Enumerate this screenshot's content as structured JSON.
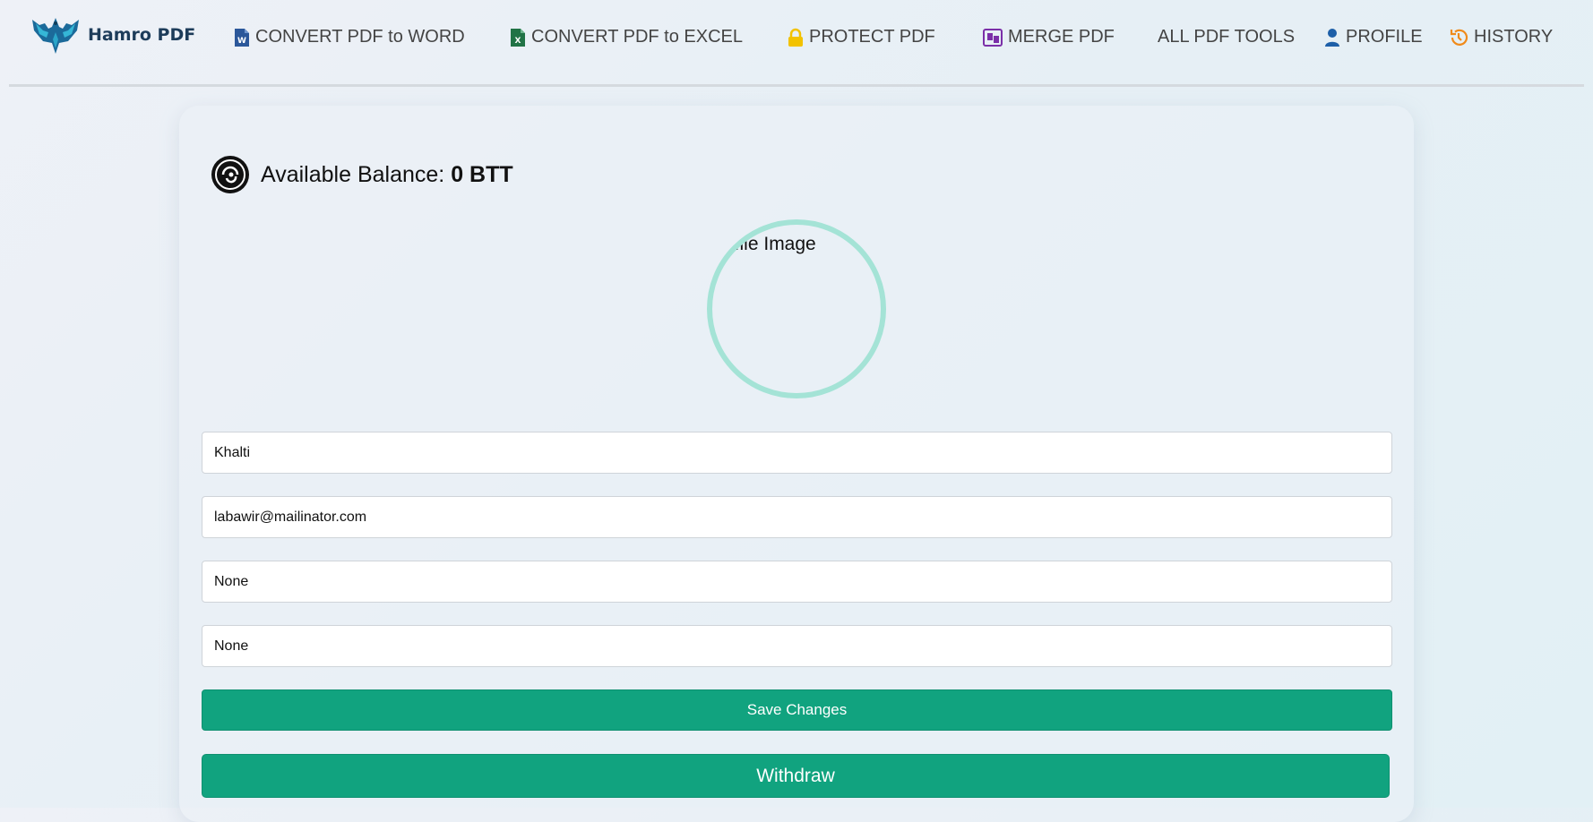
{
  "brand": {
    "name": "Hamro PDF",
    "logo_icon": "eagle-logo-icon"
  },
  "nav": {
    "items": [
      {
        "label": "CONVERT PDF to WORD",
        "icon": "word-file-icon",
        "color": "#2b579a"
      },
      {
        "label": "CONVERT PDF to EXCEL",
        "icon": "excel-file-icon",
        "color": "#217346"
      },
      {
        "label": "PROTECT PDF",
        "icon": "lock-icon",
        "color": "#f2c200"
      },
      {
        "label": "MERGE PDF",
        "icon": "merge-icon",
        "color": "#7b2fa8"
      },
      {
        "label": "ALL PDF TOOLS",
        "icon": "",
        "color": ""
      },
      {
        "label": "PROFILE",
        "icon": "user-icon",
        "color": "#1d5fa8"
      },
      {
        "label": "HISTORY",
        "icon": "history-icon",
        "color": "#f08a1a"
      }
    ]
  },
  "balance": {
    "label": "Available Balance:",
    "amount": "0 BTT",
    "icon": "btt-coin-icon"
  },
  "profile": {
    "image_alt": "Profile Image",
    "ring_color": "#a4e3d6"
  },
  "form": {
    "name_value": "Khalti",
    "email_value": "labawir@mailinator.com",
    "field3_value": "None",
    "field4_value": "None",
    "save_label": "Save Changes",
    "withdraw_label": "Withdraw"
  },
  "colors": {
    "accent": "#11a37f",
    "text": "#444444"
  }
}
